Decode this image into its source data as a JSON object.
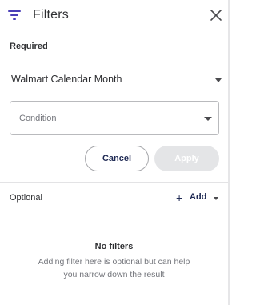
{
  "header": {
    "title": "Filters",
    "filter_icon": "filter-lines-icon",
    "close_icon": "close-icon"
  },
  "required": {
    "label": "Required",
    "calendar_select": {
      "value": "Walmart Calendar Month"
    },
    "condition_field": {
      "placeholder": "Condition"
    }
  },
  "actions": {
    "cancel_label": "Cancel",
    "apply_label": "Apply"
  },
  "optional": {
    "label": "Optional",
    "add_label": "Add"
  },
  "empty_state": {
    "title": "No filters",
    "description": "Adding filter here is optional but can help you narrow down the result"
  },
  "colors": {
    "accent": "#4a3fb8",
    "primary_text": "#2e2f32",
    "muted_text": "#74767c",
    "button_text": "#1f2a54",
    "disabled_button": "#e4e5e7"
  }
}
